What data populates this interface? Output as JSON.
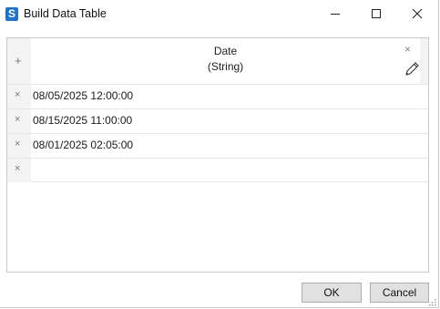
{
  "window": {
    "title": "Build Data Table",
    "app_icon_glyph": "S",
    "app_icon_color": "#1e72c8"
  },
  "grid": {
    "add_column_symbol": "+",
    "column": {
      "name": "Date",
      "type": "(String)",
      "remove_symbol": "×"
    },
    "rows": [
      {
        "remove_symbol": "×",
        "date": "08/05/2025 12:00:00"
      },
      {
        "remove_symbol": "×",
        "date": "08/15/2025 11:00:00"
      },
      {
        "remove_symbol": "×",
        "date": "08/01/2025 02:05:00"
      },
      {
        "remove_symbol": "×",
        "date": ""
      }
    ]
  },
  "buttons": {
    "ok_label": "OK",
    "cancel_label": "Cancel"
  },
  "icons": {
    "minimize": "minimize-icon",
    "maximize": "maximize-icon",
    "close": "close-icon",
    "edit": "pencil-icon",
    "resize": "resize-grip-icon"
  }
}
